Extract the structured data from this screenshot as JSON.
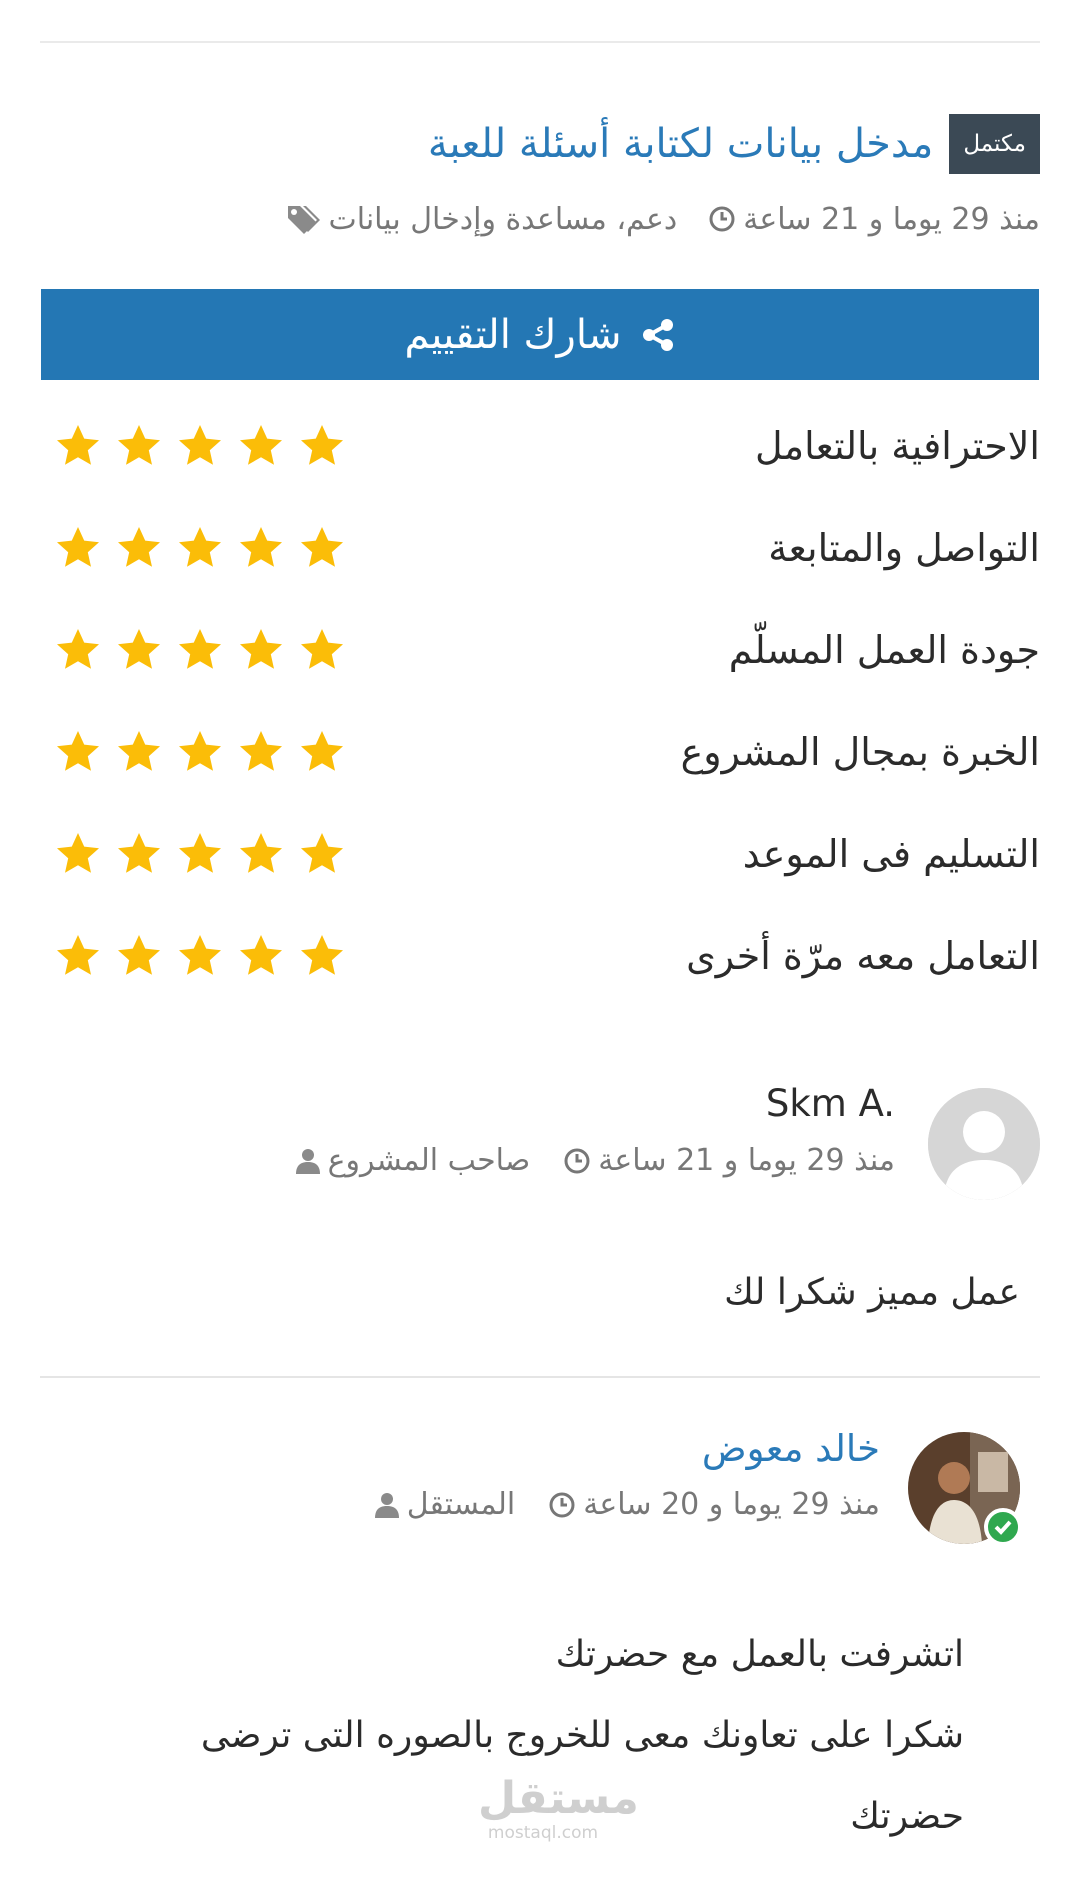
{
  "project": {
    "status": "مكتمل",
    "title": "مدخل بيانات لكتابة أسئلة للعبة",
    "categories": "دعم، مساعدة وإدخال بيانات",
    "published": "منذ 29 يوما و 21 ساعة"
  },
  "share_bar": {
    "label": "شارك التقييم"
  },
  "ratings": [
    {
      "label": "الاحترافية بالتعامل",
      "stars": 5,
      "max": 5
    },
    {
      "label": "التواصل والمتابعة",
      "stars": 5,
      "max": 5
    },
    {
      "label": "جودة العمل المسلّم",
      "stars": 5,
      "max": 5
    },
    {
      "label": "الخبرة بمجال المشروع",
      "stars": 5,
      "max": 5
    },
    {
      "label": "التسليم فى الموعد",
      "stars": 5,
      "max": 5
    },
    {
      "label": "التعامل معه مرّة أخرى",
      "stars": 5,
      "max": 5
    }
  ],
  "comments": [
    {
      "name": "Skm A.",
      "role": "صاحب المشروع",
      "time": "منذ 29 يوما و 21 ساعة",
      "body": [
        "عمل مميز شكرا لك"
      ]
    },
    {
      "name": "خالد معوض",
      "role": "المستقل",
      "time": "منذ 29 يوما و 20 ساعة",
      "body": [
        "اتشرفت بالعمل مع حضرتك",
        "شكرا على تعاونك معى للخروج بالصوره التى ترضى",
        "حضرتك"
      ]
    }
  ],
  "watermark": {
    "arabic": "مستقل",
    "latin": "mostaql.com"
  },
  "colors": {
    "accent": "#2477b4",
    "link": "#2a7ab8",
    "star": "#fbbd08",
    "badge": "#3b4955",
    "verified": "#2fa84f"
  }
}
